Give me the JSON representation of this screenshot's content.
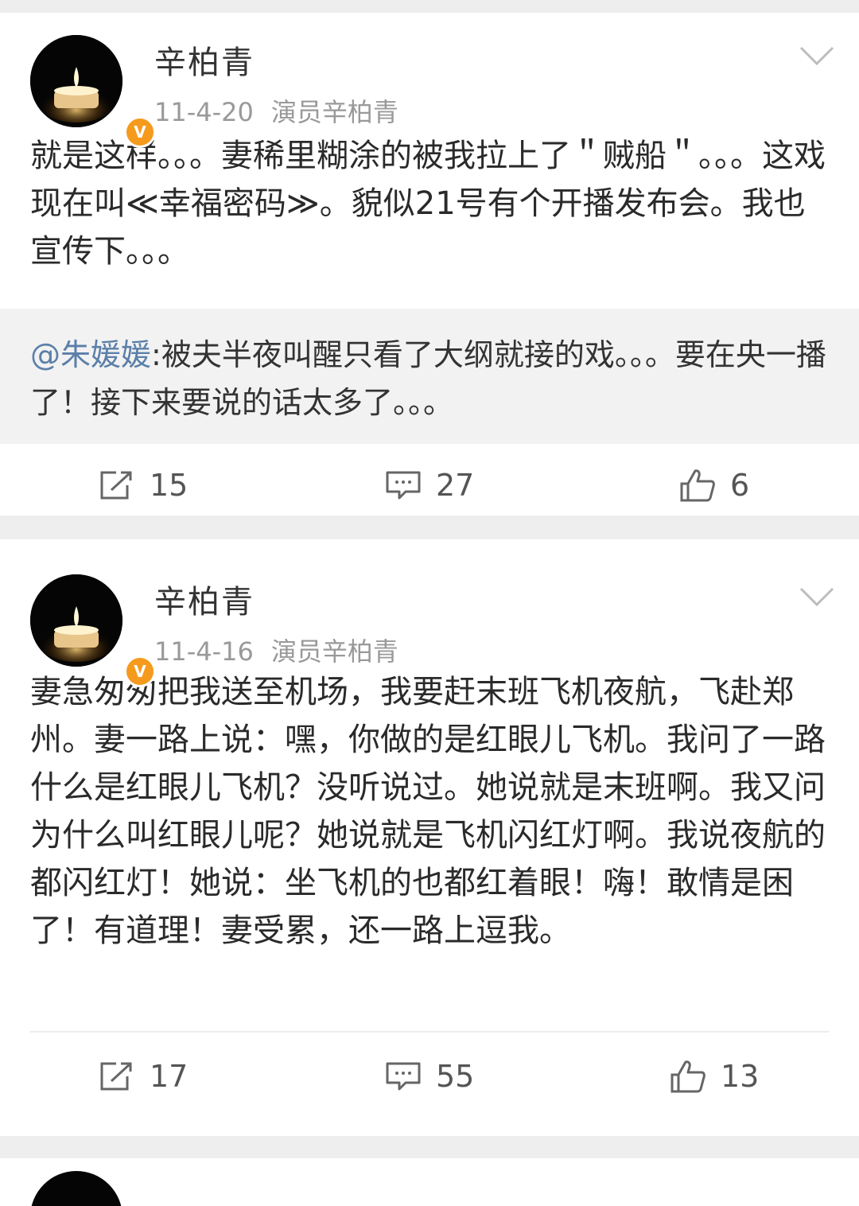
{
  "posts": [
    {
      "author": "辛柏青",
      "date": "11-4-20",
      "source": "演员辛柏青",
      "text": "就是这样。。。妻稀里糊涂的被我拉上了＂贼船＂。。。这戏现在叫≪幸福密码≫。貌似21号有个开播发布会。我也宣传下。。。",
      "repost": {
        "mention": "@朱媛媛",
        "text": ":被夫半夜叫醒只看了大纲就接的戏。。。要在央一播了！接下来要说的话太多了。。。"
      },
      "reposts": "15",
      "comments": "27",
      "likes": "6"
    },
    {
      "author": "辛柏青",
      "date": "11-4-16",
      "source": "演员辛柏青",
      "text": "妻急匆匆把我送至机场，我要赶末班飞机夜航，飞赴郑州。妻一路上说：嘿，你做的是红眼儿飞机。我问了一路什么是红眼儿飞机？没听说过。她说就是末班啊。我又问为什么叫红眼儿呢？她说就是飞机闪红灯啊。我说夜航的都闪红灯！她说：坐飞机的也都红着眼！嗨！敢情是困了！有道理！妻受累，还一路上逗我。",
      "reposts": "17",
      "comments": "55",
      "likes": "13"
    }
  ],
  "badge_symbol": "V",
  "icons": [
    "repost-icon",
    "comment-icon",
    "like-icon",
    "chevron-down-icon",
    "candle-avatar"
  ]
}
